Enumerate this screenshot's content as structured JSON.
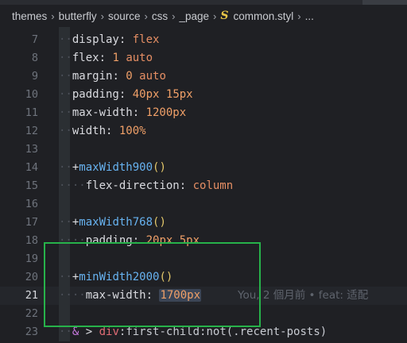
{
  "breadcrumb": {
    "items": [
      "themes",
      "butterfly",
      "source",
      "css",
      "_page"
    ],
    "file_icon_glyph": "S",
    "file_name": "common.styl",
    "trailing": "..."
  },
  "lines": [
    {
      "num": "7",
      "indent": "··",
      "tokens": [
        {
          "t": "prop",
          "v": "display"
        },
        {
          "t": "colon",
          "v": ": "
        },
        {
          "t": "kw",
          "v": "flex"
        }
      ]
    },
    {
      "num": "8",
      "indent": "··",
      "tokens": [
        {
          "t": "prop",
          "v": "flex"
        },
        {
          "t": "colon",
          "v": ": "
        },
        {
          "t": "num",
          "v": "1"
        },
        {
          "t": "plain",
          "v": " "
        },
        {
          "t": "kw",
          "v": "auto"
        }
      ]
    },
    {
      "num": "9",
      "indent": "··",
      "tokens": [
        {
          "t": "prop",
          "v": "margin"
        },
        {
          "t": "colon",
          "v": ": "
        },
        {
          "t": "num",
          "v": "0"
        },
        {
          "t": "plain",
          "v": " "
        },
        {
          "t": "kw",
          "v": "auto"
        }
      ]
    },
    {
      "num": "10",
      "indent": "··",
      "tokens": [
        {
          "t": "prop",
          "v": "padding"
        },
        {
          "t": "colon",
          "v": ": "
        },
        {
          "t": "num",
          "v": "40px"
        },
        {
          "t": "plain",
          "v": " "
        },
        {
          "t": "num",
          "v": "15px"
        }
      ]
    },
    {
      "num": "11",
      "indent": "··",
      "tokens": [
        {
          "t": "prop",
          "v": "max-width"
        },
        {
          "t": "colon",
          "v": ": "
        },
        {
          "t": "num",
          "v": "1200px"
        }
      ]
    },
    {
      "num": "12",
      "indent": "··",
      "tokens": [
        {
          "t": "prop",
          "v": "width"
        },
        {
          "t": "colon",
          "v": ": "
        },
        {
          "t": "num",
          "v": "100%"
        }
      ]
    },
    {
      "num": "13",
      "indent": "",
      "tokens": []
    },
    {
      "num": "14",
      "indent": "··",
      "tokens": [
        {
          "t": "plain",
          "v": "+"
        },
        {
          "t": "mixin",
          "v": "maxWidth900"
        },
        {
          "t": "paren",
          "v": "()"
        }
      ]
    },
    {
      "num": "15",
      "indent": "····",
      "tokens": [
        {
          "t": "prop",
          "v": "flex-direction"
        },
        {
          "t": "colon",
          "v": ": "
        },
        {
          "t": "kw",
          "v": "column"
        }
      ]
    },
    {
      "num": "16",
      "indent": "",
      "tokens": []
    },
    {
      "num": "17",
      "indent": "··",
      "tokens": [
        {
          "t": "plain",
          "v": "+"
        },
        {
          "t": "mixin",
          "v": "maxWidth768"
        },
        {
          "t": "paren",
          "v": "()"
        }
      ]
    },
    {
      "num": "18",
      "indent": "····",
      "tokens": [
        {
          "t": "prop",
          "v": "padding"
        },
        {
          "t": "colon",
          "v": ": "
        },
        {
          "t": "num",
          "v": "20px"
        },
        {
          "t": "plain",
          "v": " "
        },
        {
          "t": "num",
          "v": "5px"
        }
      ]
    },
    {
      "num": "19",
      "indent": "",
      "tokens": []
    },
    {
      "num": "20",
      "indent": "··",
      "tokens": [
        {
          "t": "plain",
          "v": "+"
        },
        {
          "t": "mixin",
          "v": "minWidth2000"
        },
        {
          "t": "paren",
          "v": "()"
        }
      ]
    },
    {
      "num": "21",
      "indent": "····",
      "current": true,
      "tokens": [
        {
          "t": "prop",
          "v": "max-width"
        },
        {
          "t": "colon",
          "v": ": "
        },
        {
          "t": "hl",
          "v": "1700px"
        }
      ],
      "blame": "You, 2 個月前 • feat: 适配"
    },
    {
      "num": "22",
      "indent": "",
      "tokens": []
    },
    {
      "num": "23",
      "indent": "··",
      "tokens": [
        {
          "t": "sel-amp",
          "v": "&"
        },
        {
          "t": "plain",
          "v": " > "
        },
        {
          "t": "sel-tag",
          "v": "div"
        },
        {
          "t": "sel-pseudo",
          "v": ":first-child:not(.recent-posts)"
        }
      ]
    }
  ]
}
